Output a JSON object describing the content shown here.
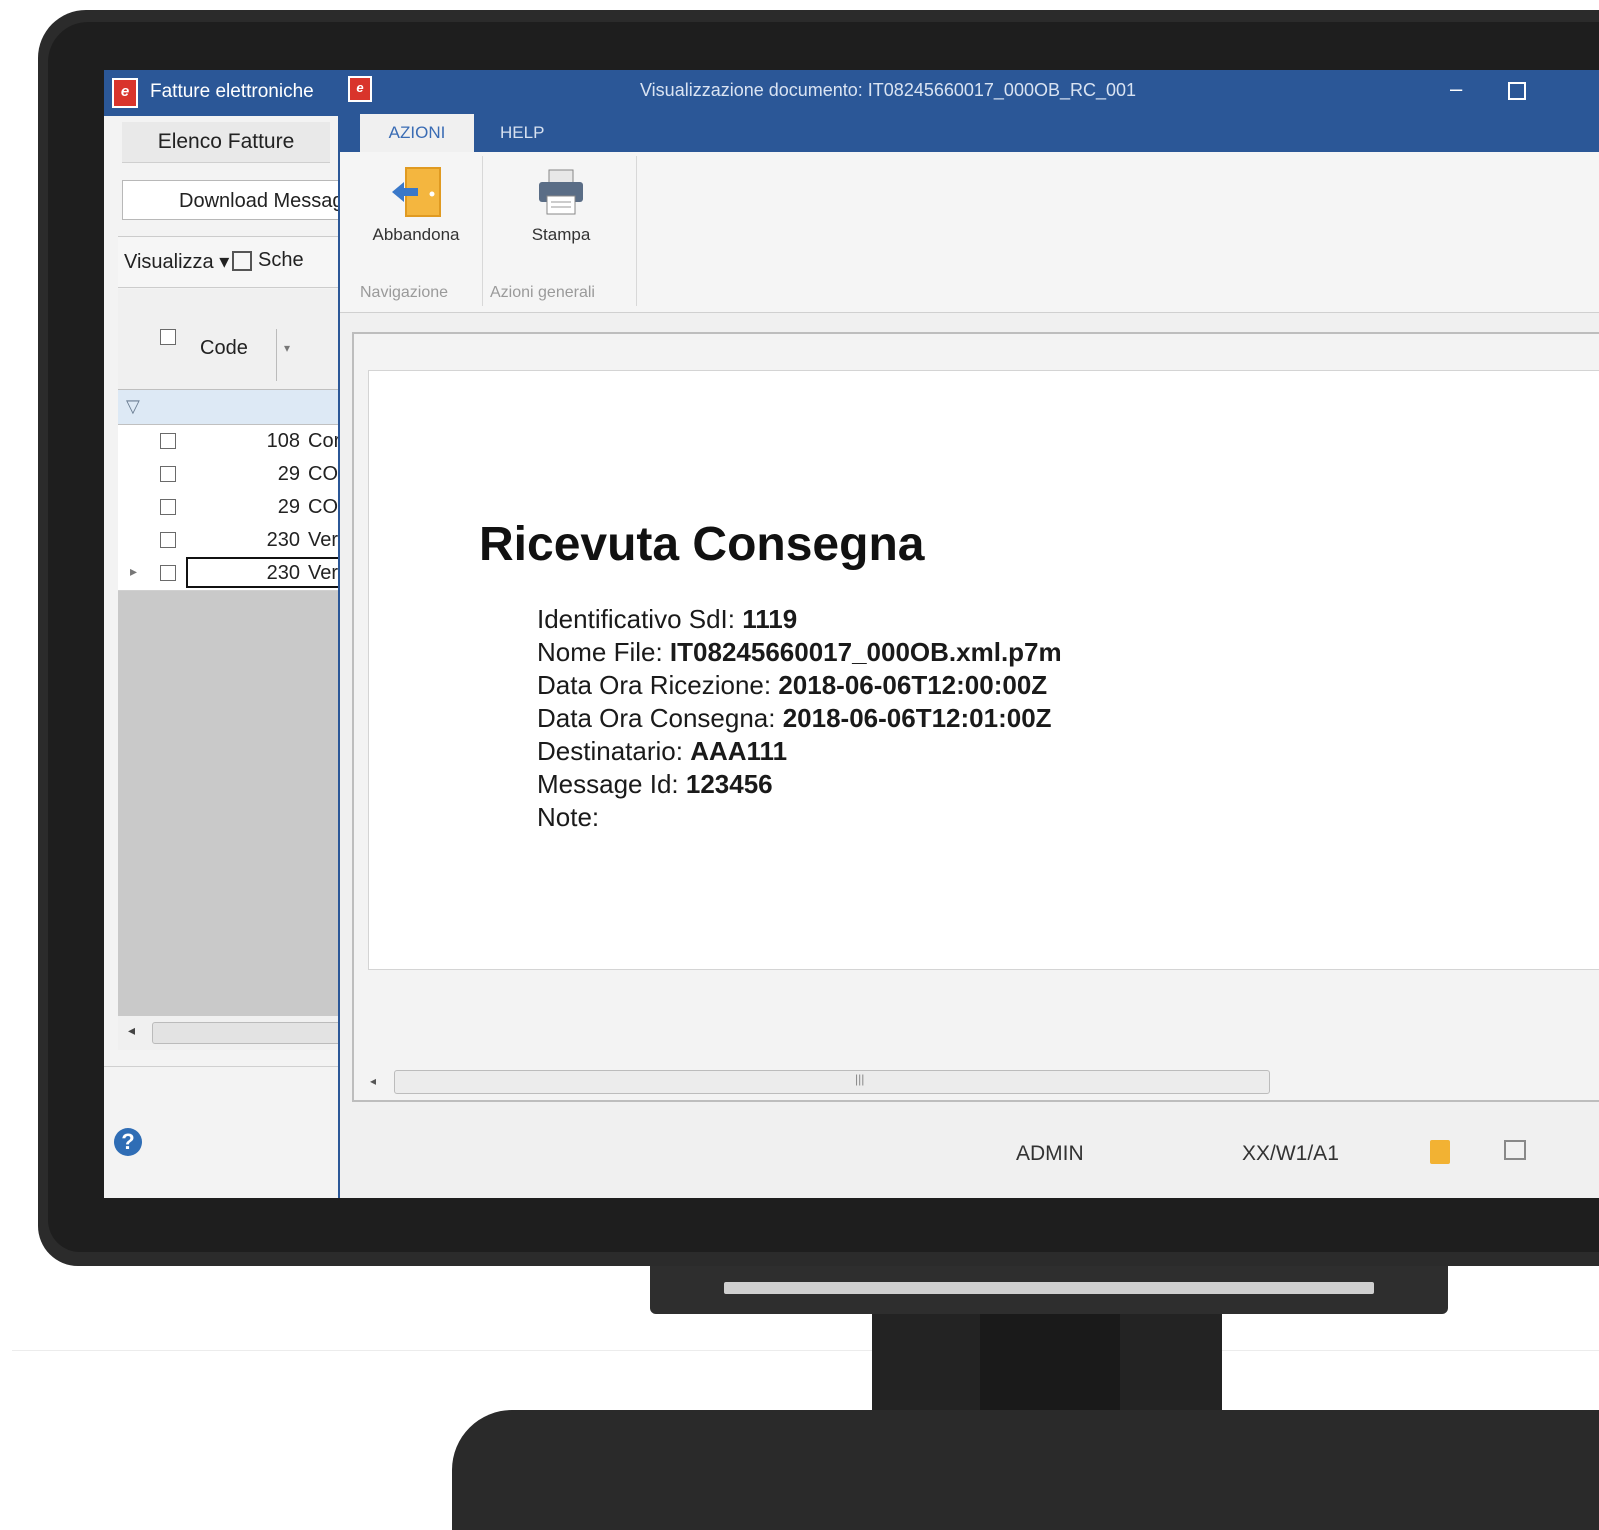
{
  "left_window": {
    "title": "Fatture elettroniche",
    "tab_label": "Elenco Fatture",
    "download_button": "Download Messag",
    "toolbar": {
      "visualizza": "Visualizza ▾",
      "schede": "Sche"
    },
    "grid": {
      "code_header": "Code",
      "rows": [
        {
          "code": "108",
          "desc": "Cor"
        },
        {
          "code": "29",
          "desc": "COI"
        },
        {
          "code": "29",
          "desc": "COI"
        },
        {
          "code": "230",
          "desc": "Ver"
        },
        {
          "code": "230",
          "desc": "Ver"
        }
      ]
    },
    "help_icon": "?"
  },
  "doc_window": {
    "title": "Visualizzazione documento: IT08245660017_000OB_RC_001",
    "ribbon_tabs": [
      "AZIONI",
      "HELP"
    ],
    "buttons": {
      "abbandona": "Abbandona",
      "stampa": "Stampa"
    },
    "groups": {
      "navigazione": "Navigazione",
      "azioni_generali": "Azioni generali"
    },
    "document": {
      "heading": "Ricevuta Consegna",
      "fields": [
        {
          "label": "Identificativo SdI: ",
          "value": "1119"
        },
        {
          "label": "Nome File: ",
          "value": "IT08245660017_000OB.xml.p7m"
        },
        {
          "label": "Data Ora Ricezione: ",
          "value": "2018-06-06T12:00:00Z"
        },
        {
          "label": "Data Ora Consegna: ",
          "value": "2018-06-06T12:01:00Z"
        },
        {
          "label": "Destinatario: ",
          "value": "AAA111"
        },
        {
          "label": "Message Id: ",
          "value": "123456"
        },
        {
          "label": "Note: ",
          "value": ""
        }
      ]
    },
    "status": {
      "user": "ADMIN",
      "path": "XX/W1/A1"
    }
  },
  "colors": {
    "titlebar": "#2b5797",
    "accent_tab_text": "#3a6cb4",
    "monitor": "#2b2b2b"
  },
  "icons": [
    "app-logo-icon",
    "exit-door-icon",
    "printer-icon",
    "help-icon",
    "filter-icon",
    "schede-icon",
    "minimize-icon",
    "maximize-icon",
    "folder-check-icon",
    "network-icon"
  ]
}
